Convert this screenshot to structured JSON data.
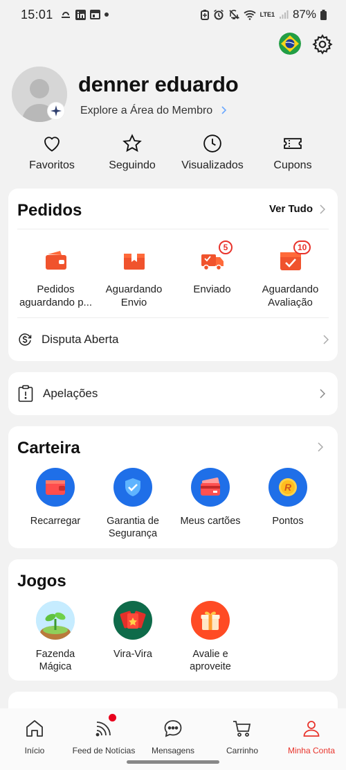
{
  "status_bar": {
    "time": "15:01",
    "battery": "87%",
    "network": "LTE1"
  },
  "profile": {
    "name": "denner eduardo",
    "member_link": "Explore a Área do Membro"
  },
  "shortcuts": [
    {
      "label": "Favoritos",
      "icon": "heart-icon"
    },
    {
      "label": "Seguindo",
      "icon": "star-icon"
    },
    {
      "label": "Visualizados",
      "icon": "clock-icon"
    },
    {
      "label": "Cupons",
      "icon": "ticket-icon"
    }
  ],
  "orders": {
    "title": "Pedidos",
    "see_all": "Ver Tudo",
    "items": [
      {
        "label": "Pedidos\naguardando p...",
        "icon": "wallet-icon",
        "badge": ""
      },
      {
        "label": "Aguardando\nEnvio",
        "icon": "package-icon",
        "badge": ""
      },
      {
        "label": "Enviado",
        "icon": "truck-icon",
        "badge": "5"
      },
      {
        "label": "Aguardando\nAvaliação",
        "icon": "review-icon",
        "badge": "10"
      }
    ],
    "dispute": "Disputa Aberta"
  },
  "appeals": {
    "label": "Apelações"
  },
  "wallet": {
    "title": "Carteira",
    "items": [
      {
        "label": "Recarregar",
        "icon": "wallet-recharge-icon"
      },
      {
        "label": "Garantia de\nSegurança",
        "icon": "shield-icon"
      },
      {
        "label": "Meus cartões",
        "icon": "cards-icon"
      },
      {
        "label": "Pontos",
        "icon": "points-coin-icon"
      }
    ]
  },
  "games": {
    "title": "Jogos",
    "items": [
      {
        "label": "Fazenda\nMágica",
        "icon": "sprout-icon"
      },
      {
        "label": "Vira-Vira",
        "icon": "cards-flip-icon"
      },
      {
        "label": "Avalie e\naproveite",
        "icon": "gift-icon"
      }
    ]
  },
  "bottom_nav": [
    {
      "label": "Início",
      "icon": "home-icon",
      "active": false
    },
    {
      "label": "Feed de Notícias",
      "icon": "feed-icon",
      "active": false
    },
    {
      "label": "Mensagens",
      "icon": "chat-icon",
      "active": false
    },
    {
      "label": "Carrinho",
      "icon": "cart-icon",
      "active": false
    },
    {
      "label": "Minha Conta",
      "icon": "user-icon",
      "active": true
    }
  ],
  "colors": {
    "accent": "#e8332b",
    "background": "#f2f2f2",
    "card": "#ffffff"
  }
}
